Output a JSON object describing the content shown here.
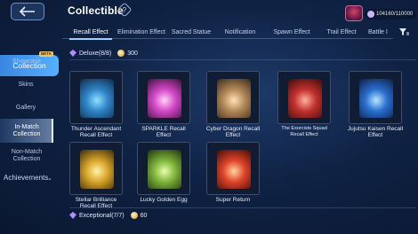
{
  "header": {
    "title": "Collectible",
    "help_icon": "?",
    "currency_value": "104160/110000"
  },
  "sidebar": {
    "section": "Collection",
    "items": [
      {
        "label": "Showcase",
        "badge": "BETA"
      },
      {
        "label": "Skins"
      },
      {
        "label": "Gallery"
      },
      {
        "label": "In-Match Collection",
        "selected": true
      },
      {
        "label": "Non-Match Collection"
      }
    ],
    "achievements": "Achievements"
  },
  "tabs": [
    {
      "label": "Recall Effect",
      "active": true
    },
    {
      "label": "Elimination Effect"
    },
    {
      "label": "Sacred Statue"
    },
    {
      "label": "Notification"
    },
    {
      "label": "Spawn Effect"
    },
    {
      "label": "Trail Effect"
    },
    {
      "label": "Battle I"
    }
  ],
  "sections": [
    {
      "label": "Deluxe(8/8)",
      "tokens": "300"
    },
    {
      "label": "Exceptional(7/7)",
      "tokens": "60"
    }
  ],
  "cards": [
    {
      "name": "Thunder Ascendant Recall Effect",
      "color": "#2f86c8"
    },
    {
      "name": "SPARKLE Recall Effect",
      "color": "#d449c8"
    },
    {
      "name": "Cyber Dragon Recall Effect",
      "color": "#b48a5a"
    },
    {
      "name": "The Exorcists Squad Recall Effect",
      "color": "#c2312f"
    },
    {
      "name": "Jujutsu Kaisen Recall Effect",
      "color": "#2b6fd0"
    },
    {
      "name": "Stellar Brilliance Recall Effect",
      "color": "#d9a52a"
    },
    {
      "name": "Lucky Golden Egg",
      "color": "#7fb43a"
    },
    {
      "name": "Super Return",
      "color": "#e0432a"
    }
  ],
  "icons": {
    "back": "back-arrow-icon",
    "filter": "filter-icon",
    "gem": "gem-icon",
    "token": "token-icon"
  }
}
